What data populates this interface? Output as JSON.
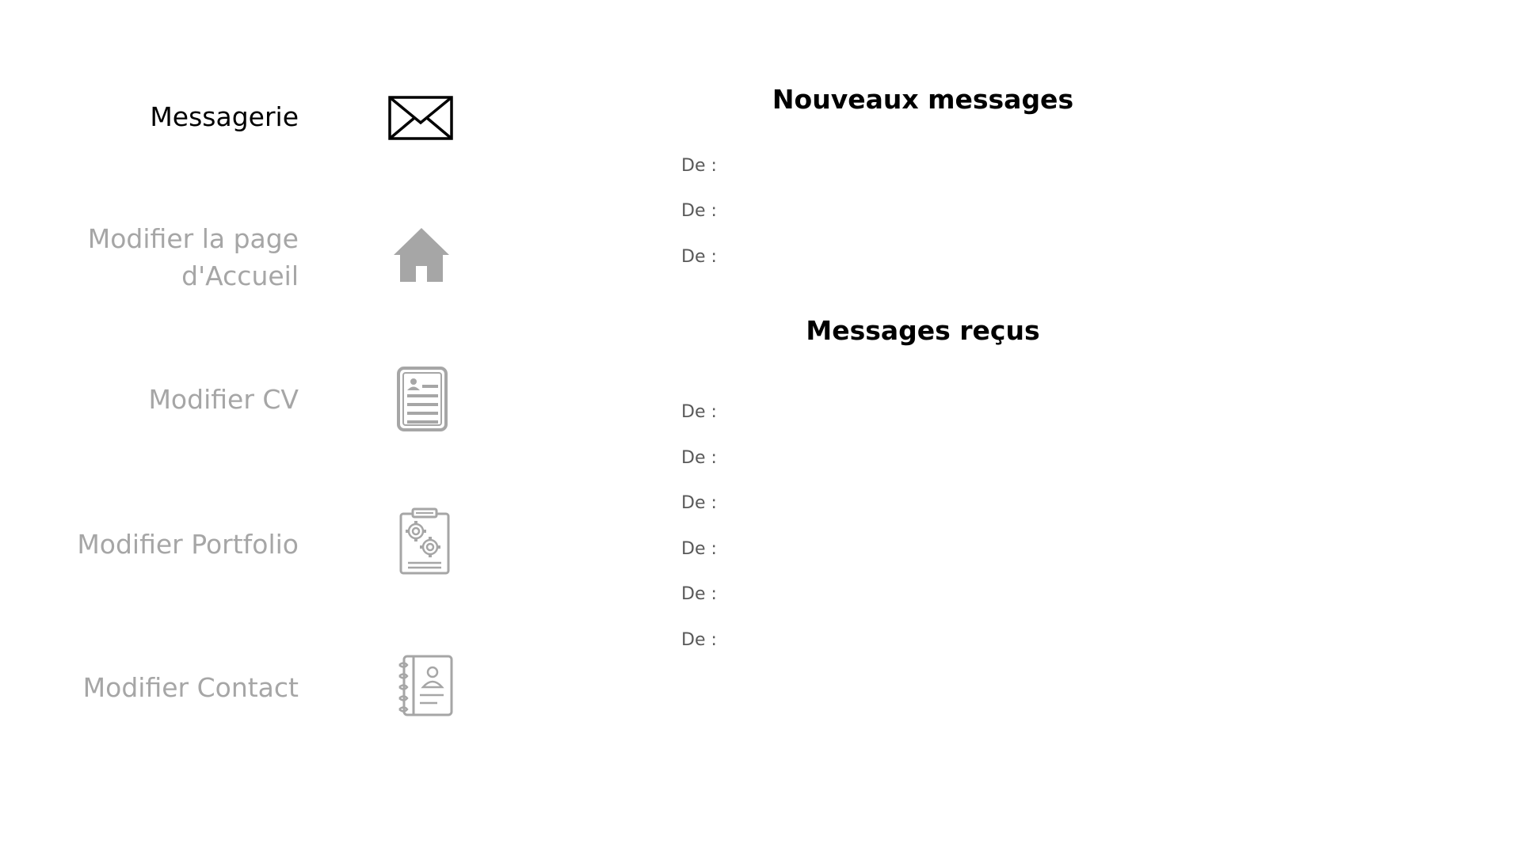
{
  "nav": {
    "items": [
      {
        "label": "Messagerie",
        "icon": "envelope-icon",
        "active": true
      },
      {
        "label": "Modifier la page\nd'Accueil",
        "icon": "home-icon",
        "active": false
      },
      {
        "label": "Modifier CV",
        "icon": "document-icon",
        "active": false
      },
      {
        "label": "Modifier Portfolio",
        "icon": "clipboard-gears-icon",
        "active": false
      },
      {
        "label": "Modifier Contact",
        "icon": "address-book-icon",
        "active": false
      }
    ]
  },
  "main": {
    "new_messages": {
      "title": "Nouveaux messages",
      "rows": [
        "De :",
        "De :",
        "De :"
      ]
    },
    "received_messages": {
      "title": "Messages reçus",
      "rows": [
        "De :",
        "De :",
        "De :",
        "De :",
        "De :",
        "De :"
      ]
    }
  },
  "colors": {
    "active": "#000000",
    "inactive": "#a6a6a6",
    "row_text": "#595959"
  }
}
